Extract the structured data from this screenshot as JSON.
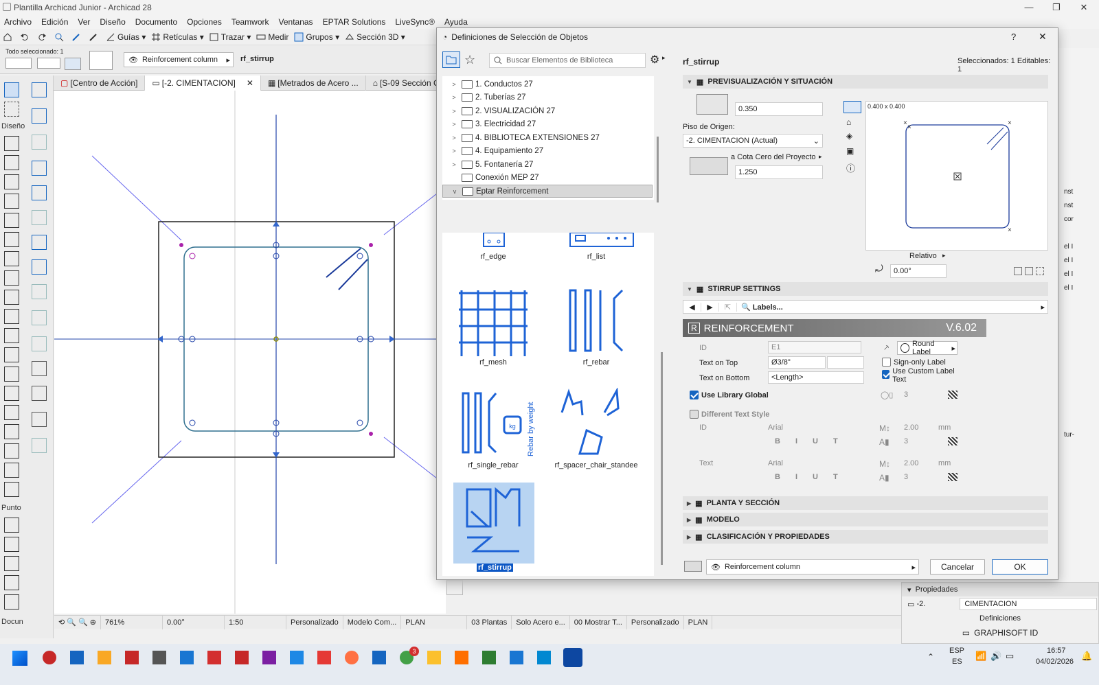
{
  "window": {
    "title": "Plantilla Archicad Junior - Archicad 28"
  },
  "menu": [
    "Archivo",
    "Edición",
    "Ver",
    "Diseño",
    "Documento",
    "Opciones",
    "Teamwork",
    "Ventanas",
    "EPTAR Solutions",
    "LiveSync®",
    "Ayuda"
  ],
  "toolbar": {
    "guias": "Guías",
    "reticulas": "Retículas",
    "trazar": "Trazar",
    "medir": "Medir",
    "grupos": "Grupos",
    "seccion3d": "Sección 3D"
  },
  "infobox": {
    "selected": "Todo seleccionado: 1",
    "layer": "Reinforcement column",
    "object": "rf_stirrup"
  },
  "tabs": [
    "[Centro de Acción]",
    "[-2. CIMENTACION]",
    "[Metrados de Acero ...",
    "[S-09 Sección Co"
  ],
  "toolbox": {
    "diseno": "Diseño",
    "punto": "Punto",
    "docu": "Docun"
  },
  "status": {
    "zoom": "761%",
    "angle": "0.00°",
    "scale": "1:50",
    "custom": "Personalizado",
    "model": "Modelo Com...",
    "plan": "PLAN",
    "plantas": "03 Plantas",
    "solo": "Solo Acero e...",
    "mostrar": "00 Mostrar T...",
    "custom2": "Personalizado",
    "plan2": "PLAN"
  },
  "dialog": {
    "title": "Definiciones de Selección de Objetos",
    "search_placeholder": "Buscar Elementos de Biblioteca",
    "tree": [
      "1. Conductos 27",
      "2. Tuberías 27",
      "2. VISUALIZACIÓN 27",
      "3. Electricidad 27",
      "4. BIBLIOTECA EXTENSIONES 27",
      "4. Equipamiento 27",
      "5. Fontanería 27",
      "Conexión MEP 27",
      "Eptar Reinforcement"
    ],
    "thumbs": [
      "rf_edge",
      "rf_list",
      "rf_mesh",
      "rf_rebar",
      "rf_single_rebar",
      "rf_spacer_chair_standee",
      "rf_stirrup"
    ],
    "rebar_weight_text": "Rebar by weight",
    "rebar_weight_kg": "kg",
    "object_name": "rf_stirrup",
    "selection_info": "Seleccionados: 1 Editables: 1",
    "sec_preview": "PREVISUALIZACIÓN Y SITUACIÓN",
    "height": "0.350",
    "piso_label": "Piso de Origen:",
    "piso_value": "-2. CIMENTACION (Actual)",
    "cota_label": "a Cota Cero del Proyecto",
    "cota_value": "1.250",
    "preview_size": "0.400 x 0.400",
    "relativo": "Relativo",
    "angle": "0.00°",
    "sec_stirrup": "STIRRUP SETTINGS",
    "labels_btn": "Labels...",
    "banner_title": "REINFORCEMENT",
    "banner_version": "V.6.02",
    "id_label": "ID",
    "id_value": "E1",
    "round_label": "Round Label",
    "text_top_label": "Text on Top",
    "text_top_value": "Ø3/8\"",
    "sign_only": "Sign-only Label",
    "text_bottom_label": "Text on Bottom",
    "text_bottom_value": "<Length>",
    "use_custom": "Use Custom Label Text",
    "use_library": "Use Library Global",
    "pen_val": "3",
    "diff_style": "Different Text Style",
    "id2": "ID",
    "font": "Arial",
    "size": "2.00",
    "unit": "mm",
    "pen2": "3",
    "text2": "Text",
    "font2": "Arial",
    "size2": "2.00",
    "unit2": "mm",
    "pen3": "3",
    "sec_planta": "PLANTA Y SECCIÓN",
    "sec_modelo": "MODELO",
    "sec_clasif": "CLASIFICACIÓN Y PROPIEDADES",
    "layer": "Reinforcement column",
    "cancel": "Cancelar",
    "ok": "OK",
    "help": "?",
    "close": "✕"
  },
  "props": {
    "title": "Propiedades",
    "floor_num": "-2.",
    "floor_name": "CIMENTACION",
    "defs": "Definiciones",
    "graphisoft": "GRAPHISOFT ID"
  },
  "tray": {
    "lang1": "ESP",
    "lang2": "ES",
    "time": "16:57",
    "date": "04/02/2026",
    "badge": "3"
  },
  "right_strip": [
    "nst",
    "nst",
    "cor",
    "el I",
    "el I",
    "el I",
    "el I",
    "tur-"
  ]
}
